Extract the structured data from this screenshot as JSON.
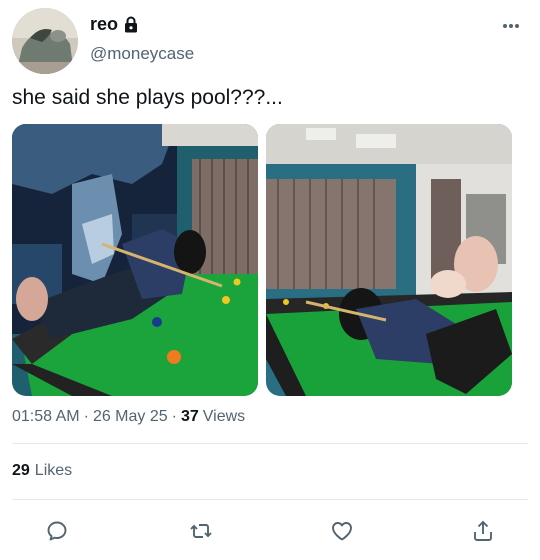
{
  "user": {
    "display_name": "reo",
    "handle": "@moneycase",
    "avatar_icon": "avatar-photo",
    "lock_icon": "lock-icon"
  },
  "tweet": {
    "text": "she said she plays pool???..."
  },
  "media": {
    "count": 2,
    "photos": [
      "pool-table-photo-left",
      "pool-table-photo-right"
    ]
  },
  "meta": {
    "time": "01:58 AM",
    "separator": "·",
    "date": "26 May 25",
    "views_count": "37",
    "views_label": "Views"
  },
  "stats": {
    "likes_count": "29",
    "likes_label": "Likes"
  },
  "actions": {
    "reply_icon": "reply-icon",
    "retweet_icon": "retweet-icon",
    "like_icon": "heart-icon",
    "share_icon": "share-icon"
  },
  "colors": {
    "text": "#0f1419",
    "secondary": "#536471",
    "divider": "#e6e9ec",
    "accent": "#1d9bf0"
  }
}
